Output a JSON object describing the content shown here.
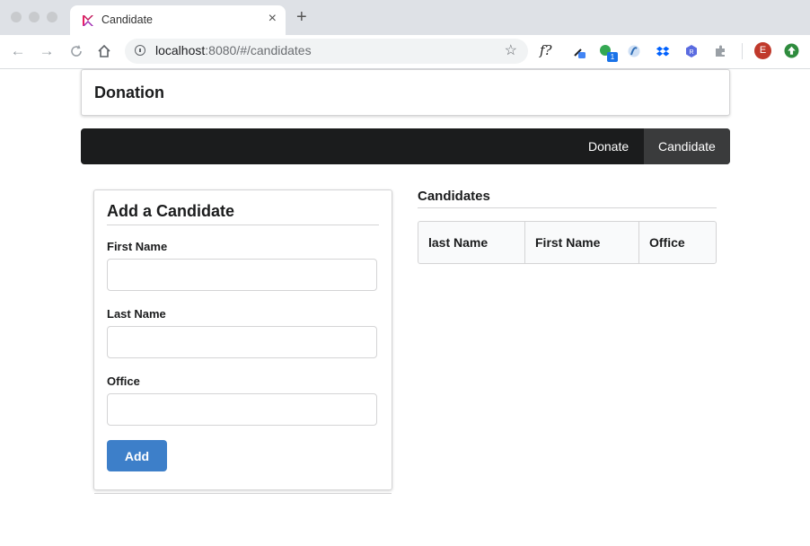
{
  "browser": {
    "tab_title": "Candidate",
    "url_host": "localhost",
    "url_rest": ":8080/#/candidates",
    "new_tab": "+",
    "tab_close": "×",
    "extension_badge": "1",
    "profile_initial": "E",
    "extension_f_label": "f?"
  },
  "header": {
    "title": "Donation"
  },
  "nav": {
    "items": [
      {
        "label": "Donate",
        "active": false
      },
      {
        "label": "Candidate",
        "active": true
      }
    ]
  },
  "form": {
    "title": "Add a Candidate",
    "fields": [
      {
        "label": "First Name",
        "value": "",
        "placeholder": ""
      },
      {
        "label": "Last Name",
        "value": "",
        "placeholder": ""
      },
      {
        "label": "Office",
        "value": "",
        "placeholder": ""
      }
    ],
    "submit_label": "Add",
    "submit_color": "#3d7fc9"
  },
  "candidates": {
    "title": "Candidates",
    "columns": [
      "last Name",
      "First Name",
      "Office"
    ],
    "rows": []
  },
  "colors": {
    "menubar": "#1b1c1d",
    "menu_active": "#3a3b3c"
  }
}
